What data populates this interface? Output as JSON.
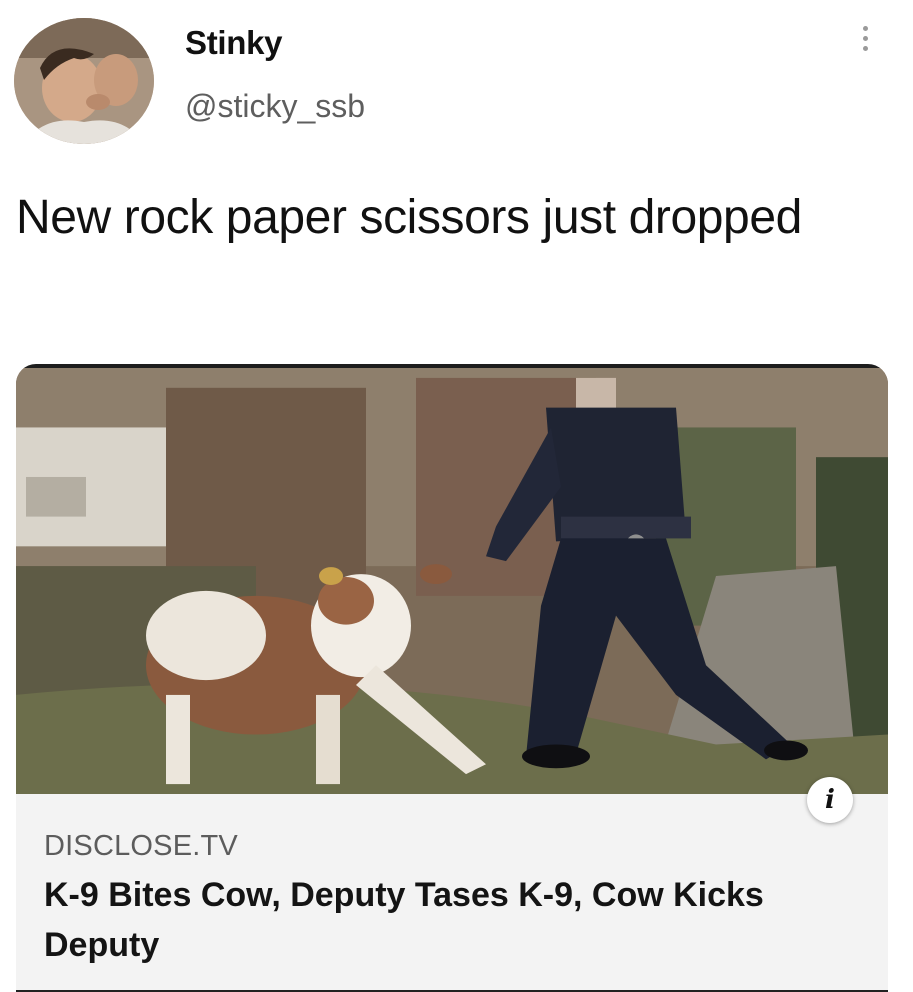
{
  "author": {
    "display_name": "Stinky",
    "handle": "@sticky_ssb"
  },
  "tweet": {
    "text": "New rock paper scissors just dropped"
  },
  "link_card": {
    "source": "DISCLOSE.TV",
    "title": "K-9 Bites Cow, Deputy Tases K-9, Cow Kicks Deputy",
    "info_icon": "info-icon"
  },
  "icons": {
    "more": "more-vertical-icon",
    "info": "info-icon"
  },
  "colors": {
    "text_primary": "#111111",
    "text_secondary": "#5e5e5e",
    "card_background": "#f3f3f3"
  }
}
